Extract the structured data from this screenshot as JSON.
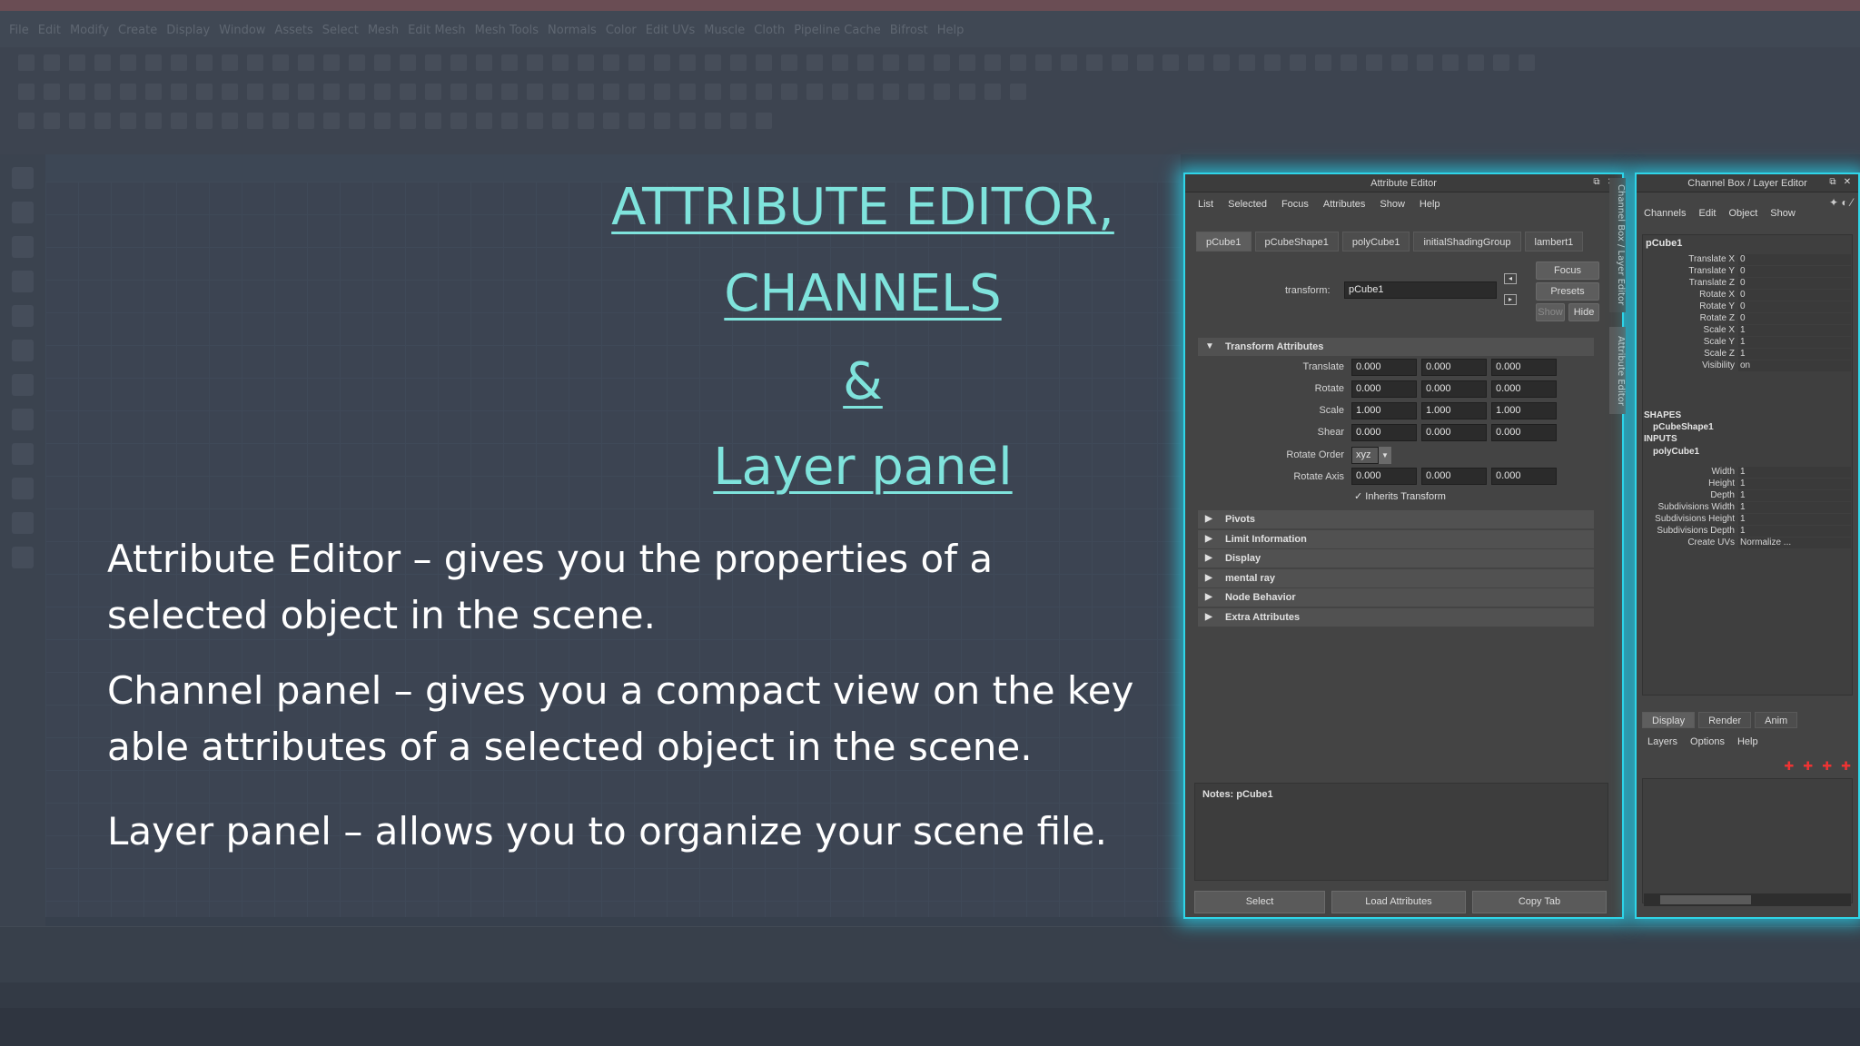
{
  "slide": {
    "title_lines": [
      "ATTRIBUTE EDITOR,",
      "CHANNELS",
      "&",
      "Layer panel"
    ],
    "bullets": [
      "Attribute Editor – gives you the properties of a selected object in the scene.",
      "Channel panel – gives you a compact view on the key able attributes of a selected object in the scene.",
      "Layer panel – allows you to organize your scene file."
    ]
  },
  "attribute_editor": {
    "title": "Attribute Editor",
    "menu": [
      "List",
      "Selected",
      "Focus",
      "Attributes",
      "Show",
      "Help"
    ],
    "tabs": [
      "pCube1",
      "pCubeShape1",
      "polyCube1",
      "initialShadingGroup",
      "lambert1"
    ],
    "transform_label": "transform:",
    "transform_value": "pCube1",
    "focus_label": "Focus",
    "presets_label": "Presets",
    "show_label": "Show",
    "hide_label": "Hide",
    "section_transform": "Transform Attributes",
    "rows": [
      {
        "label": "Translate",
        "values": [
          "0.000",
          "0.000",
          "0.000"
        ]
      },
      {
        "label": "Rotate",
        "values": [
          "0.000",
          "0.000",
          "0.000"
        ]
      },
      {
        "label": "Scale",
        "values": [
          "1.000",
          "1.000",
          "1.000"
        ]
      },
      {
        "label": "Shear",
        "values": [
          "0.000",
          "0.000",
          "0.000"
        ]
      }
    ],
    "rotate_order_label": "Rotate Order",
    "rotate_order_value": "xyz",
    "rotate_axis_label": "Rotate Axis",
    "rotate_axis_values": [
      "0.000",
      "0.000",
      "0.000"
    ],
    "inherits_label": "Inherits Transform",
    "sections": [
      "Pivots",
      "Limit Information",
      "Display",
      "mental ray",
      "Node Behavior",
      "Extra Attributes"
    ],
    "notes_label": "Notes:  pCube1",
    "bottom_buttons": [
      "Select",
      "Load Attributes",
      "Copy Tab"
    ],
    "side_tabs": [
      "Channel Box / Layer Editor",
      "Attribute Editor"
    ]
  },
  "channel_box": {
    "title": "Channel Box / Layer Editor",
    "menu": [
      "Channels",
      "Edit",
      "Object",
      "Show"
    ],
    "object": "pCube1",
    "channels": [
      {
        "name": "Translate X",
        "value": "0"
      },
      {
        "name": "Translate Y",
        "value": "0"
      },
      {
        "name": "Translate Z",
        "value": "0"
      },
      {
        "name": "Rotate X",
        "value": "0"
      },
      {
        "name": "Rotate Y",
        "value": "0"
      },
      {
        "name": "Rotate Z",
        "value": "0"
      },
      {
        "name": "Scale X",
        "value": "1"
      },
      {
        "name": "Scale Y",
        "value": "1"
      },
      {
        "name": "Scale Z",
        "value": "1"
      },
      {
        "name": "Visibility",
        "value": "on"
      }
    ],
    "shapes_header": "SHAPES",
    "shape_name": "pCubeShape1",
    "inputs_header": "INPUTS",
    "input_name": "polyCube1",
    "inputs": [
      {
        "name": "Width",
        "value": "1"
      },
      {
        "name": "Height",
        "value": "1"
      },
      {
        "name": "Depth",
        "value": "1"
      },
      {
        "name": "Subdivisions Width",
        "value": "1"
      },
      {
        "name": "Subdivisions Height",
        "value": "1"
      },
      {
        "name": "Subdivisions Depth",
        "value": "1"
      },
      {
        "name": "Create UVs",
        "value": "Normalize ..."
      }
    ],
    "layer_tabs": [
      "Display",
      "Render",
      "Anim"
    ],
    "layer_menu": [
      "Layers",
      "Options",
      "Help"
    ]
  },
  "background_menu": [
    "File",
    "Edit",
    "Modify",
    "Create",
    "Display",
    "Window",
    "Assets",
    "Select",
    "Mesh",
    "Edit Mesh",
    "Mesh Tools",
    "Normals",
    "Color",
    "Edit UVs",
    "Muscle",
    "Cloth",
    "Pipeline Cache",
    "Bifrost",
    "Help"
  ],
  "colors": {
    "accent": "#7fe3dc",
    "glow": "#2fd5e8",
    "panel": "#444444"
  }
}
